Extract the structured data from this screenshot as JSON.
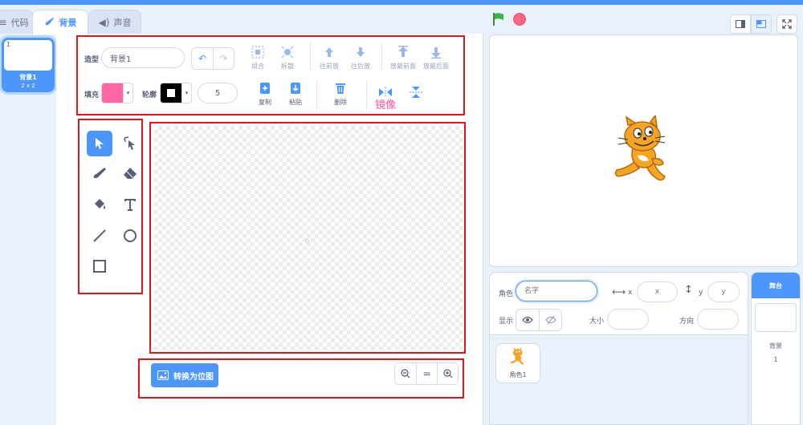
{
  "tabs": [
    {
      "label": "代码",
      "icon": "code-icon"
    },
    {
      "label": "背景",
      "icon": "brush-icon"
    },
    {
      "label": "声音",
      "icon": "speaker-icon"
    }
  ],
  "costume_list": {
    "items": [
      {
        "number": "1",
        "name": "背景1",
        "size": "2 x 2"
      }
    ]
  },
  "paint_toolbar": {
    "costume_label": "造型",
    "costume_name": "背景1",
    "group_label": "组合",
    "ungroup_label": "拆散",
    "forward_label": "往前放",
    "backward_label": "往后放",
    "front_label": "放最前面",
    "back_label": "放最后面",
    "fill_label": "填充",
    "outline_label": "轮廓",
    "outline_width": "5",
    "copy_label": "复制",
    "paste_label": "粘贴",
    "delete_label": "删除",
    "mirror_label": "镜像"
  },
  "colors": {
    "accent": "#4c97ff",
    "fill_color": "#ff66a3",
    "outline_color": "#000000",
    "highlight": "#e0161e",
    "mirror_text": "#ff4fa0",
    "green_flag": "#3ab54a",
    "stop": "#ff6680"
  },
  "tools": [
    "select-icon",
    "reshape-icon",
    "brush-icon",
    "eraser-icon",
    "fill-icon",
    "text-icon",
    "line-icon",
    "circle-icon",
    "rectangle-icon"
  ],
  "canvas_footer": {
    "convert_label": "转换为位图",
    "zoom_out": "−",
    "zoom_reset": "=",
    "zoom_in": "+"
  },
  "sprite_info": {
    "sprite_label": "角色",
    "name_placeholder": "名字",
    "x_label": "x",
    "x_placeholder": "x",
    "y_label": "y",
    "y_placeholder": "y",
    "show_label": "显示",
    "size_label": "大小",
    "direction_label": "方向"
  },
  "sprites": [
    {
      "name": "角色1"
    }
  ],
  "stage_pane": {
    "title": "舞台",
    "backdrops_label": "背景",
    "backdrop_count": "1"
  }
}
